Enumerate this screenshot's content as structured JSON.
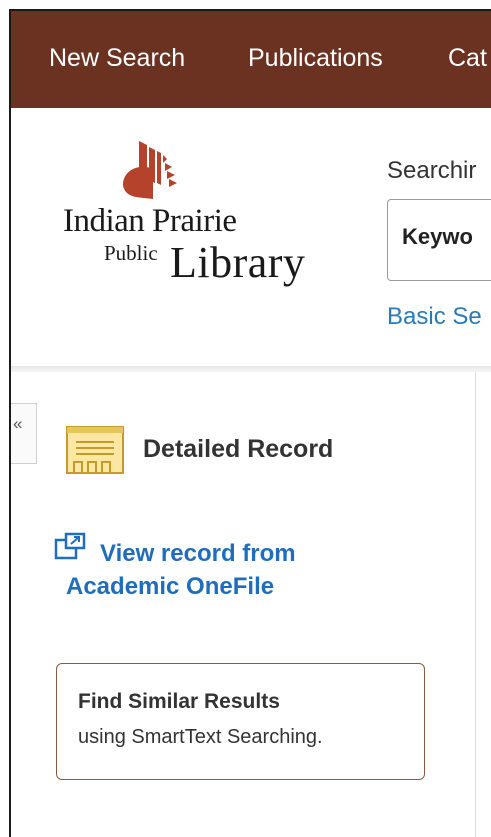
{
  "nav": {
    "items": [
      {
        "label": "New Search"
      },
      {
        "label": "Publications"
      },
      {
        "label": "Cat"
      }
    ]
  },
  "logo": {
    "line1": "Indian Prairie",
    "line2_small": "Public",
    "line2_large": "Library",
    "brand_color": "#b5432b"
  },
  "search": {
    "label": "Searchir",
    "mode_value": "Keywo",
    "basic_link": "Basic Se"
  },
  "record": {
    "collapse_glyph": "«",
    "title": "Detailed Record",
    "view_link_line1": "View record from",
    "view_link_line2": "Academic OneFile"
  },
  "similar": {
    "title": "Find Similar Results",
    "subtitle": "using SmartText Searching."
  },
  "colors": {
    "nav_bg": "#6b3222",
    "link": "#1f6dbd",
    "box_border": "#8a5a40"
  }
}
